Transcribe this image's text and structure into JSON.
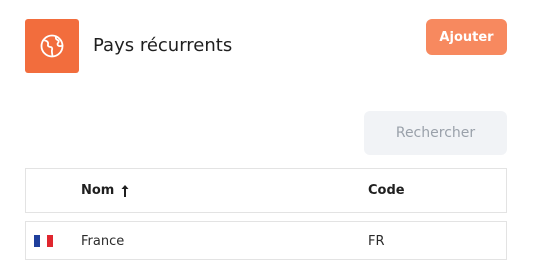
{
  "header": {
    "icon": "globe-icon",
    "title": "Pays récurrents",
    "add_label": "Ajouter",
    "accent_color": "#f26d3d"
  },
  "search": {
    "label": "Rechercher"
  },
  "table": {
    "columns": [
      {
        "label": "Nom",
        "sort": "ascending",
        "sort_icon": "arrow-up-icon"
      },
      {
        "label": "Code"
      }
    ],
    "rows": [
      {
        "flag": "france-flag-icon",
        "flag_colors": [
          "#1f3f9c",
          "#ffffff",
          "#e0262e"
        ],
        "name": "France",
        "code": "FR"
      }
    ]
  }
}
